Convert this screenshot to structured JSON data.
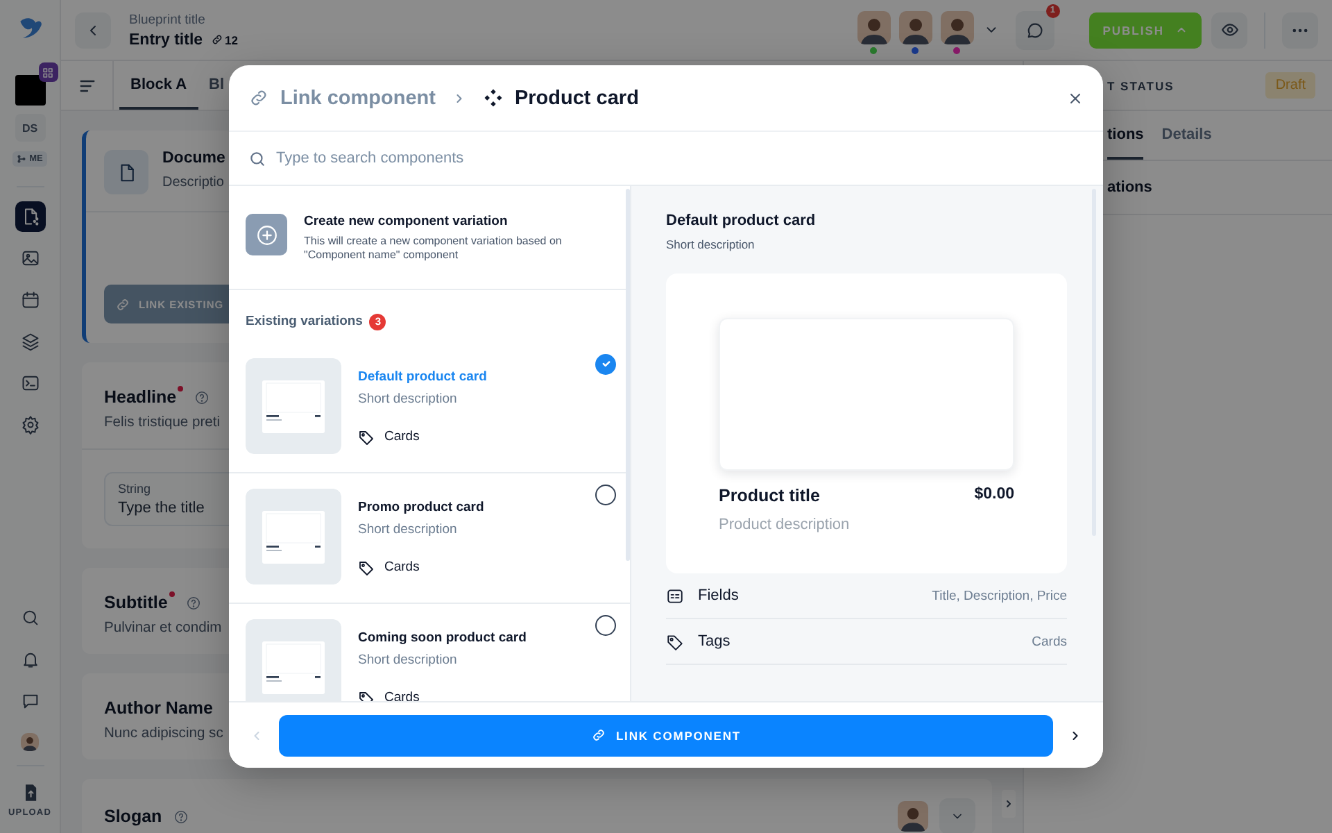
{
  "rail": {
    "workspace": "DS",
    "user_badge": "ME",
    "upload": "UPLOAD",
    "nav": [
      {
        "selected": true
      },
      {
        "selected": false
      },
      {
        "selected": false
      },
      {
        "selected": false
      },
      {
        "selected": false
      },
      {
        "selected": false
      }
    ]
  },
  "topbar": {
    "blueprint": "Blueprint title",
    "entry": "Entry title",
    "links": "12",
    "collaborators": [
      {
        "color": "#2a7a2e"
      },
      {
        "color": "#1a3a8c"
      },
      {
        "color": "#8a1a6a"
      }
    ],
    "comments_badge": "1",
    "publish": "PUBLISH"
  },
  "block_tabs": [
    {
      "label": "Block A",
      "selected": true
    },
    {
      "label": "Bl",
      "selected": false
    }
  ],
  "document": {
    "title": "Docume",
    "description": "Descriptio",
    "button": "LINK EXISTING"
  },
  "fields": [
    {
      "label": "Headline",
      "required": true,
      "help": true,
      "description": "Felis tristique preti",
      "input": {
        "type_label": "String",
        "placeholder": "Type the title"
      }
    },
    {
      "label": "Subtitle",
      "required": true,
      "help": true,
      "description": "Pulvinar et condim"
    },
    {
      "label": "Author Name",
      "required": false,
      "help": false,
      "description": "Nunc adipiscing sc"
    },
    {
      "label": "Slogan",
      "required": false,
      "help": true
    }
  ],
  "side_panel": {
    "status_label": "T STATUS",
    "status": "Draft",
    "tabs": [
      {
        "label": "tions",
        "selected": true
      },
      {
        "label": "Details",
        "selected": false
      }
    ],
    "heading": "ations"
  },
  "modal": {
    "breadcrumb": [
      "Link component",
      "Product card"
    ],
    "search": {
      "placeholder": "Type to search components"
    },
    "create": {
      "title": "Create new component variation",
      "description": "This will create a new component variation based on \"Component name\" component"
    },
    "variations_heading": "Existing variations",
    "variations_count": "3",
    "variations": [
      {
        "title": "Default product card",
        "description": "Short description",
        "tag": "Cards",
        "selected": true
      },
      {
        "title": "Promo product card",
        "description": "Short description",
        "tag": "Cards",
        "selected": false
      },
      {
        "title": "Coming soon product card",
        "description": "Short description",
        "tag": "Cards",
        "selected": false
      }
    ],
    "preview": {
      "title": "Default product card",
      "description": "Short description",
      "card": {
        "title": "Product title",
        "price": "$0.00",
        "description": "Product description"
      },
      "properties": [
        {
          "kind": "fields",
          "label": "Fields",
          "value": "Title, Description, Price"
        },
        {
          "kind": "tags",
          "label": "Tags",
          "value": "Cards"
        }
      ]
    },
    "footer": {
      "button": "LINK COMPONENT",
      "prev_disabled": true
    }
  }
}
